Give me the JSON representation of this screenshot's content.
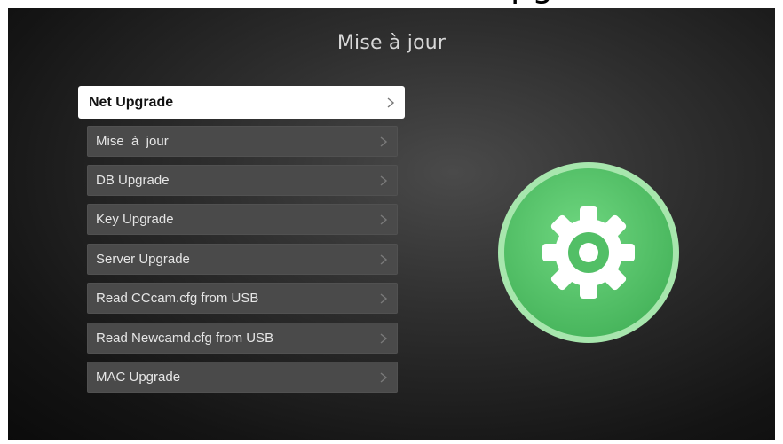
{
  "overlay": {
    "cut_text": "pg"
  },
  "header": {
    "title": "Mise à jour"
  },
  "menu": {
    "items": [
      {
        "label": "Net Upgrade",
        "selected": true
      },
      {
        "label": "Mise  à  jour",
        "selected": false
      },
      {
        "label": "DB Upgrade",
        "selected": false
      },
      {
        "label": "Key Upgrade",
        "selected": false
      },
      {
        "label": "Server Upgrade",
        "selected": false
      },
      {
        "label": "Read CCcam.cfg from USB",
        "selected": false
      },
      {
        "label": "Read Newcamd.cfg from USB",
        "selected": false
      },
      {
        "label": "MAC Upgrade",
        "selected": false
      }
    ]
  },
  "illustration": {
    "icon": "settings-gear-icon",
    "colors": {
      "circle": "#55c46b",
      "ring": "#9fe3a6",
      "gear": "#ffffff"
    }
  }
}
